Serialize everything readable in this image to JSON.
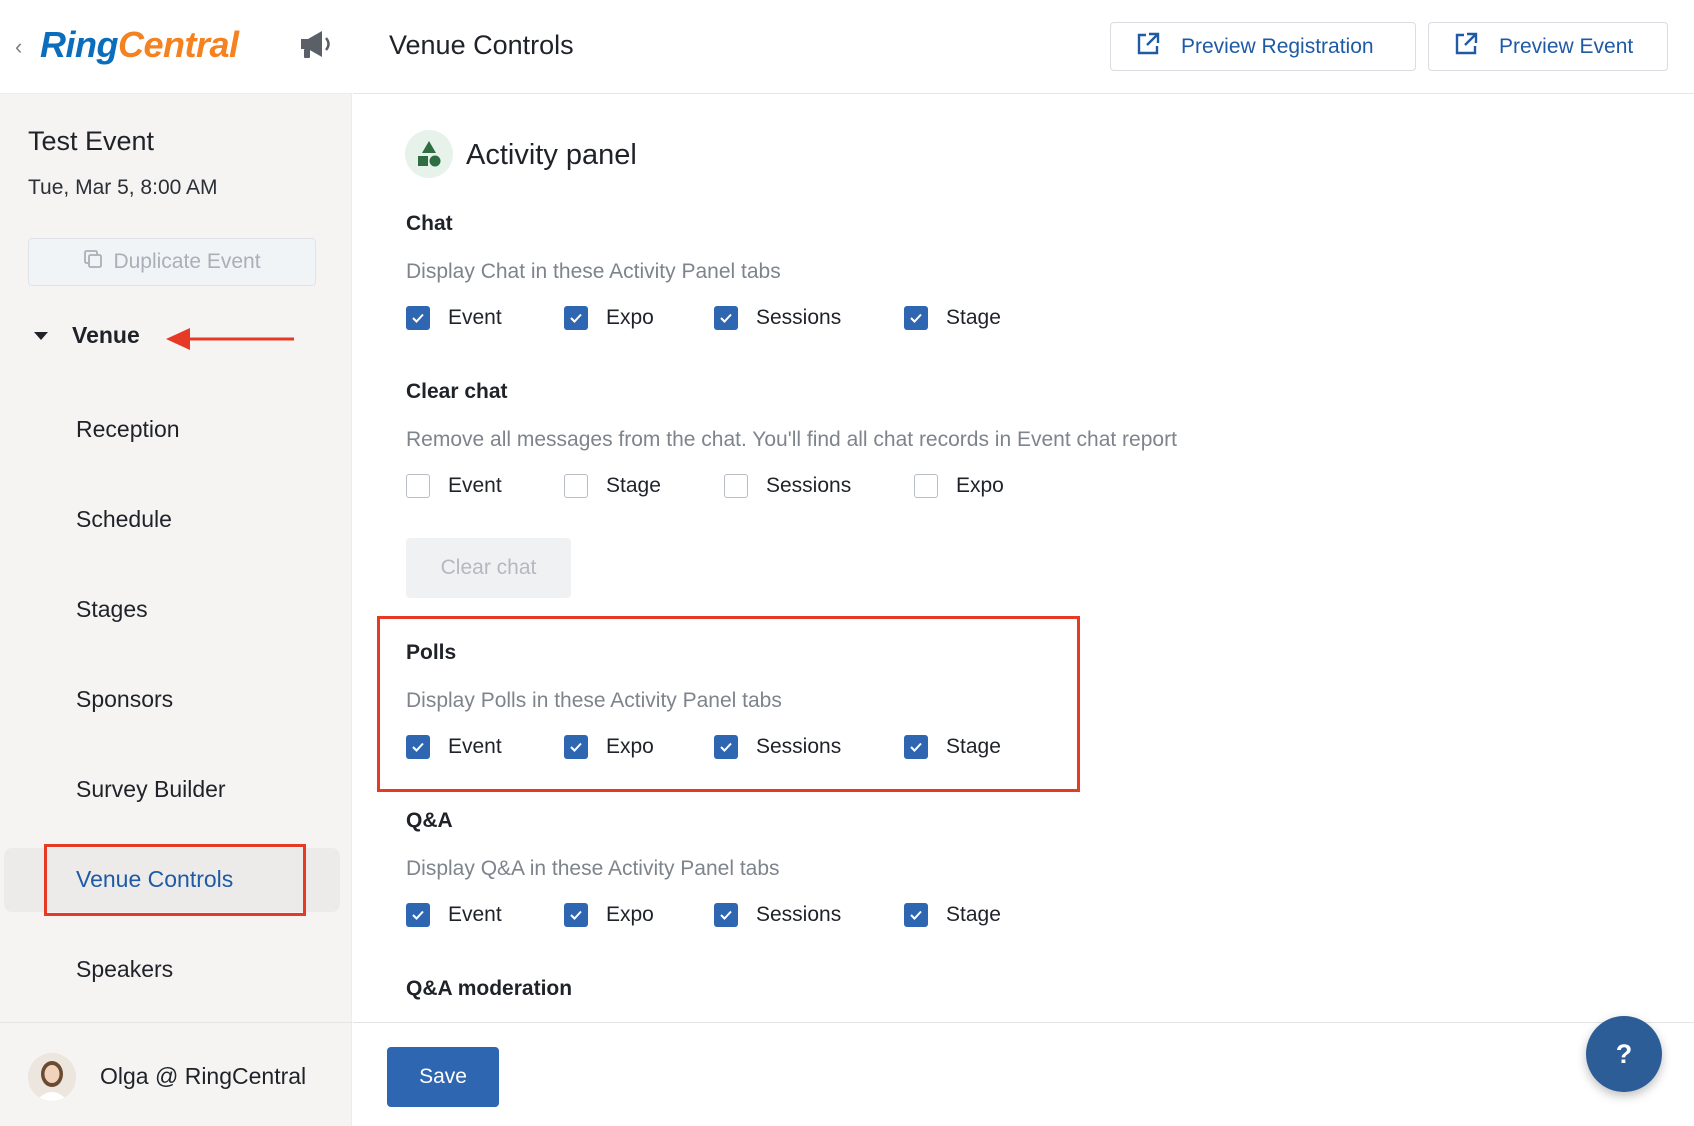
{
  "brand": {
    "logo_part1": "Ring",
    "logo_part2": "Central"
  },
  "sidebar": {
    "event_title": "Test Event",
    "event_date": "Tue, Mar 5, 8:00 AM",
    "duplicate_label": "Duplicate Event",
    "venue_label": "Venue",
    "items": [
      {
        "label": "Reception"
      },
      {
        "label": "Schedule"
      },
      {
        "label": "Stages"
      },
      {
        "label": "Sponsors"
      },
      {
        "label": "Survey Builder"
      },
      {
        "label": "Venue Controls",
        "active": true
      },
      {
        "label": "Speakers"
      }
    ],
    "user_name": "Olga @ RingCentral"
  },
  "header": {
    "title": "Venue Controls",
    "preview_registration": "Preview Registration",
    "preview_event": "Preview Event"
  },
  "main": {
    "section_title": "Activity panel",
    "chat": {
      "title": "Chat",
      "desc": "Display Chat in these Activity Panel tabs",
      "options": [
        {
          "label": "Event",
          "checked": true
        },
        {
          "label": "Expo",
          "checked": true
        },
        {
          "label": "Sessions",
          "checked": true
        },
        {
          "label": "Stage",
          "checked": true
        }
      ]
    },
    "clear_chat": {
      "title": "Clear chat",
      "desc": "Remove all messages from the chat. You'll find all chat records in Event chat report",
      "options": [
        {
          "label": "Event",
          "checked": false
        },
        {
          "label": "Stage",
          "checked": false
        },
        {
          "label": "Sessions",
          "checked": false
        },
        {
          "label": "Expo",
          "checked": false
        }
      ],
      "button": "Clear chat"
    },
    "polls": {
      "title": "Polls",
      "desc": "Display Polls in these Activity Panel tabs",
      "options": [
        {
          "label": "Event",
          "checked": true
        },
        {
          "label": "Expo",
          "checked": true
        },
        {
          "label": "Sessions",
          "checked": true
        },
        {
          "label": "Stage",
          "checked": true
        }
      ]
    },
    "qa": {
      "title": "Q&A",
      "desc": "Display Q&A in these Activity Panel tabs",
      "options": [
        {
          "label": "Event",
          "checked": true
        },
        {
          "label": "Expo",
          "checked": true
        },
        {
          "label": "Sessions",
          "checked": true
        },
        {
          "label": "Stage",
          "checked": true
        }
      ]
    },
    "qa_moderation": {
      "title": "Q&A moderation"
    }
  },
  "footer": {
    "save": "Save",
    "help": "?"
  },
  "colors": {
    "accent": "#2e66b2",
    "annotation": "#e63a26",
    "brand_blue": "#0a6ebd",
    "brand_orange": "#f58220"
  }
}
